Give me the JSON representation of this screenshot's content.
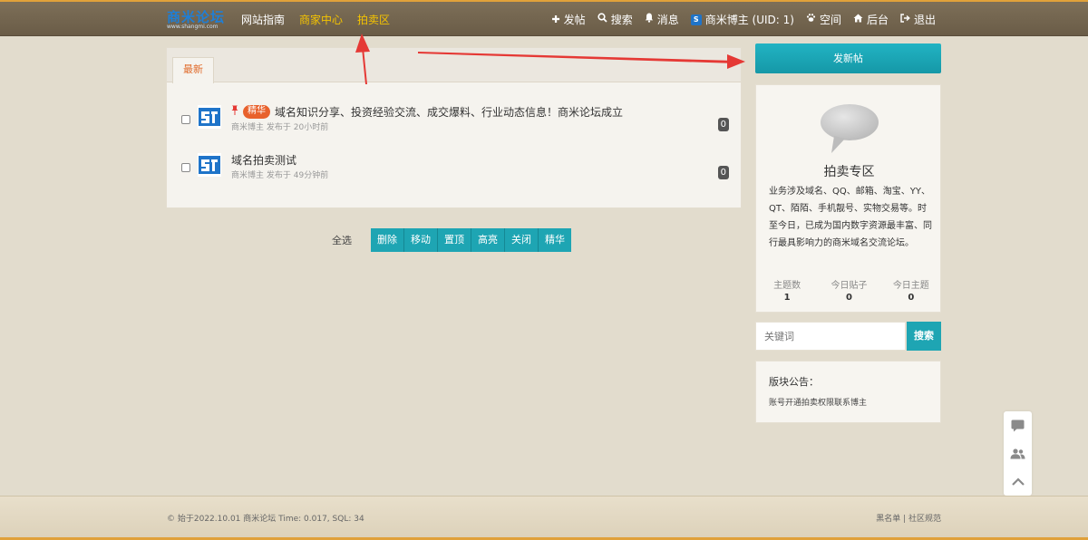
{
  "colors": {
    "accent": "#1ea5b3",
    "nav_highlight": "#f5c400",
    "badge": "#e8612c",
    "annotation_arrow": "#e53935"
  },
  "header": {
    "logo_text": "商米论坛",
    "logo_sub": "www.shangmi.com",
    "nav_left": [
      {
        "label": "网站指南",
        "highlight": false
      },
      {
        "label": "商家中心",
        "highlight": true
      },
      {
        "label": "拍卖区",
        "highlight": true
      }
    ],
    "nav_right": {
      "post": {
        "icon": "plus-icon",
        "label": "发帖"
      },
      "search": {
        "icon": "search-icon",
        "label": "搜索"
      },
      "messages": {
        "icon": "bell-icon",
        "label": "消息"
      },
      "user": {
        "icon": "user-logo-icon",
        "label": "商米博主 (UID: 1)"
      },
      "space": {
        "icon": "paw-icon",
        "label": "空间"
      },
      "admin": {
        "icon": "home-icon",
        "label": "后台"
      },
      "logout": {
        "icon": "logout-icon",
        "label": "退出"
      }
    }
  },
  "main": {
    "tab_label": "最新",
    "posts": [
      {
        "pinned": true,
        "badge": "精华",
        "title": "域名知识分享、投资经验交流、成交爆料、行业动态信息！商米论坛成立",
        "author": "商米博主",
        "time": "发布于 20小时前",
        "count": "0"
      },
      {
        "pinned": false,
        "badge": "",
        "title": "域名拍卖测试",
        "author": "商米博主",
        "time": "发布于 49分钟前",
        "count": "0"
      }
    ],
    "select_all": "全选",
    "actions": [
      "删除",
      "移动",
      "置顶",
      "高亮",
      "关闭",
      "精华"
    ]
  },
  "sidebar": {
    "post_button": "发新帖",
    "forum_name": "拍卖专区",
    "forum_desc": "业务涉及域名、QQ、邮箱、淘宝、YY、QT、陌陌、手机靓号、实物交易等。时至今日，已成为国内数字资源最丰富、同行最具影响力的商米域名交流论坛。",
    "stats": [
      {
        "label": "主题数",
        "value": "1"
      },
      {
        "label": "今日贴子",
        "value": "0"
      },
      {
        "label": "今日主题",
        "value": "0"
      }
    ],
    "search": {
      "placeholder": "关键词",
      "button": "搜索"
    },
    "notice": {
      "title": "版块公告：",
      "text": "账号开通拍卖权限联系博主"
    }
  },
  "footer": {
    "left": "© 始于2022.10.01 商米论坛 Time: 0.017, SQL: 34",
    "right": "黑名单 | 社区规范"
  },
  "float_tools": [
    "comment-icon",
    "users-icon",
    "chevron-up-icon"
  ]
}
